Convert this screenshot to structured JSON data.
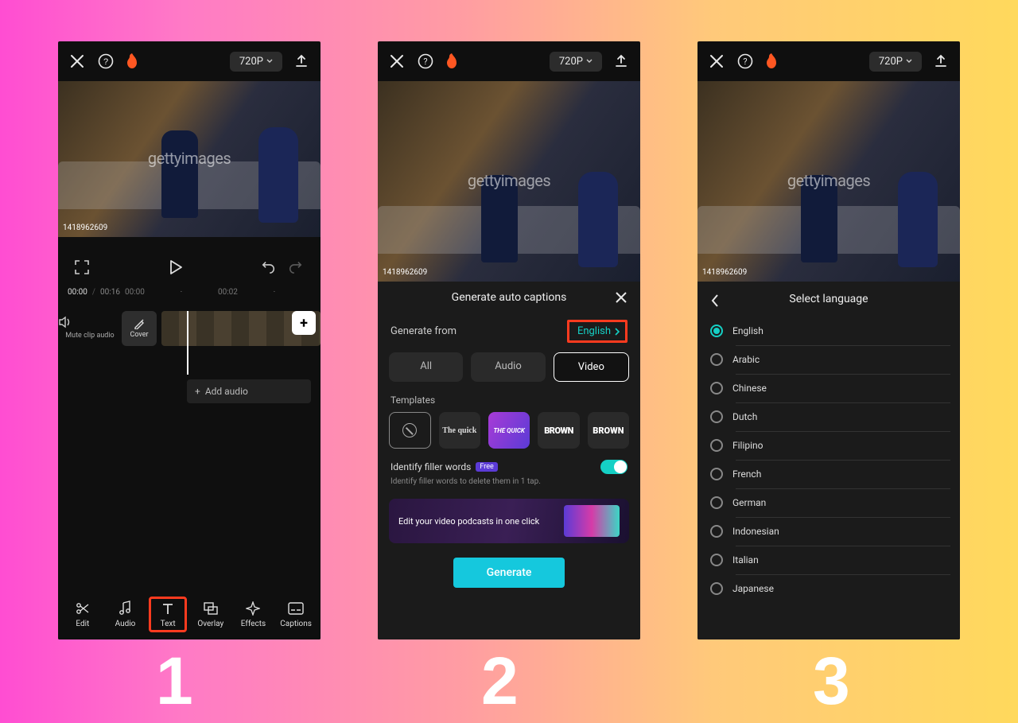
{
  "steps": {
    "one": "1",
    "two": "2",
    "three": "3"
  },
  "topbar": {
    "resolution": "720P"
  },
  "preview": {
    "watermark": "gettyimages",
    "image_id": "1418962609"
  },
  "screen1": {
    "time_current": "00:00",
    "time_total": "00:16",
    "tick1": "00:00",
    "tick2": "00:02",
    "mute_label": "Mute clip audio",
    "cover_label": "Cover",
    "add_audio": "Add audio",
    "nav": {
      "edit": "Edit",
      "audio": "Audio",
      "text": "Text",
      "overlay": "Overlay",
      "effects": "Effects",
      "captions": "Captions"
    }
  },
  "screen2": {
    "title": "Generate auto captions",
    "generate_from": "Generate from",
    "language": "English",
    "seg_all": "All",
    "seg_audio": "Audio",
    "seg_video": "Video",
    "templates_label": "Templates",
    "tmpl_quick": "The quick",
    "tmpl_tq": "THE QUICK",
    "tmpl_brown1": "BROWN",
    "tmpl_brown2": "BROWN",
    "filler_title": "Identify filler words",
    "filler_badge": "Free",
    "filler_sub": "Identify filler words to delete them in 1 tap.",
    "promo": "Edit your video podcasts in one click",
    "generate_btn": "Generate"
  },
  "screen3": {
    "title": "Select language",
    "languages": [
      "English",
      "Arabic",
      "Chinese",
      "Dutch",
      "Filipino",
      "French",
      "German",
      "Indonesian",
      "Italian",
      "Japanese"
    ],
    "selected_index": 0
  }
}
